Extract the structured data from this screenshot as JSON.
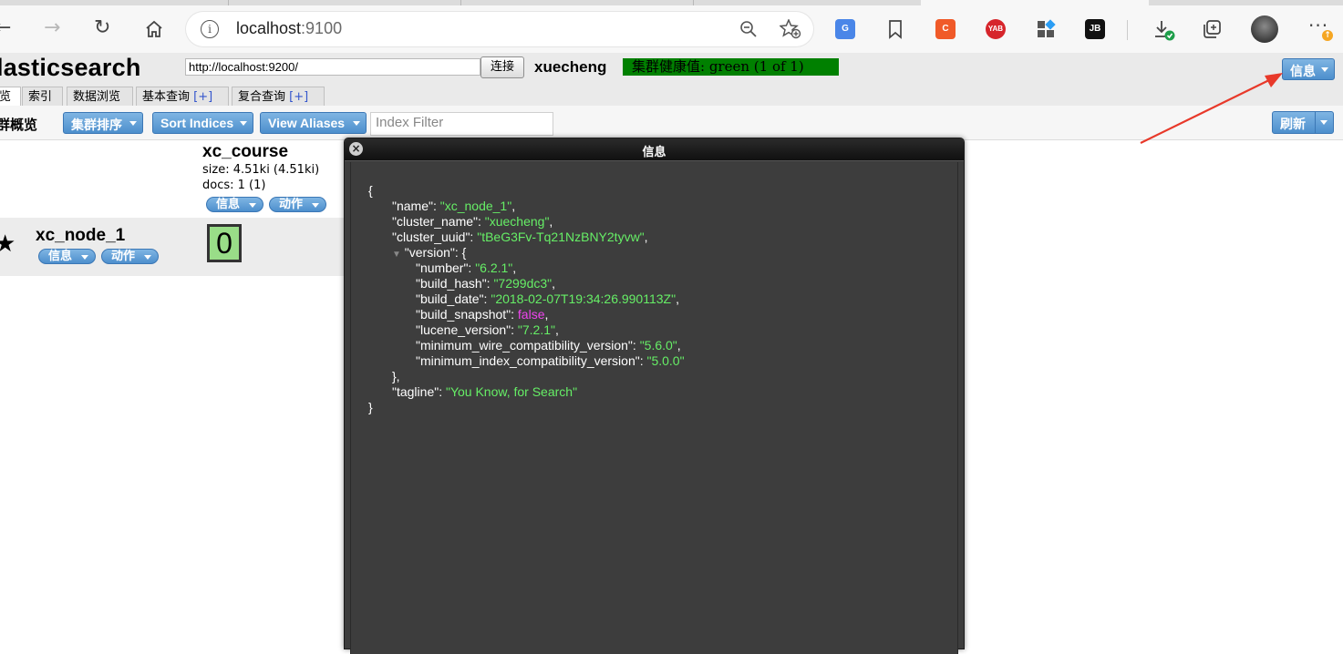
{
  "browser": {
    "address": "localhost",
    "address_port": ":9100",
    "extensions": [
      "translate-icon",
      "bookmark-icon",
      "c-extension-icon",
      "yab-extension-icon",
      "apps-icon",
      "jb-extension-icon",
      "download-icon",
      "collections-icon",
      "profile-avatar",
      "more-icon"
    ],
    "ext_labels": {
      "c": "C",
      "yab": "YAB",
      "jb": "JB"
    }
  },
  "app": {
    "title": "lasticsearch",
    "connection_url": "http://localhost:9200/",
    "connect_label": "连接",
    "cluster_name": "xuecheng",
    "health_text": "集群健康值: green (1 of 1)",
    "info_menu_label": "信息",
    "tabs": [
      {
        "label": "览",
        "plus": ""
      },
      {
        "label": "索引",
        "plus": ""
      },
      {
        "label": "数据浏览",
        "plus": ""
      },
      {
        "label": "基本查询",
        "plus": "[+]"
      },
      {
        "label": "复合查询",
        "plus": "[+]"
      }
    ],
    "overview_label": "群概览",
    "cluster_sort_label": "集群排序",
    "sort_indices_label": "Sort Indices",
    "view_aliases_label": "View Aliases",
    "index_filter_placeholder": "Index Filter",
    "refresh_label": "刷新"
  },
  "index": {
    "name": "xc_course",
    "size": "size: 4.51ki (4.51ki)",
    "docs": "docs: 1 (1)",
    "info_label": "信息",
    "action_label": "动作"
  },
  "node": {
    "name": "xc_node_1",
    "info_label": "信息",
    "action_label": "动作",
    "shard": "0"
  },
  "dialog": {
    "title": "信息",
    "json_lines": [
      {
        "k": "",
        "v": "{"
      },
      {
        "k": "\"name\": ",
        "v": "\"xc_node_1\"",
        "t": ","
      },
      {
        "k": "\"cluster_name\": ",
        "v": "\"xuecheng\"",
        "t": ","
      },
      {
        "k": "\"cluster_uuid\": ",
        "v": "\"tBeG3Fv-Tq21NzBNY2tyvw\"",
        "t": ","
      },
      {
        "k": "\"version\": {",
        "v": ""
      },
      {
        "k": "\"number\": ",
        "v": "\"6.2.1\"",
        "t": ","
      },
      {
        "k": "\"build_hash\": ",
        "v": "\"7299dc3\"",
        "t": ","
      },
      {
        "k": "\"build_date\": ",
        "v": "\"2018-02-07T19:34:26.990113Z\"",
        "t": ","
      },
      {
        "k": "\"build_snapshot\": ",
        "b": "false",
        "t": ","
      },
      {
        "k": "\"lucene_version\": ",
        "v": "\"7.2.1\"",
        "t": ","
      },
      {
        "k": "\"minimum_wire_compatibility_version\": ",
        "v": "\"5.6.0\"",
        "t": ","
      },
      {
        "k": "\"minimum_index_compatibility_version\": ",
        "v": "\"5.0.0\""
      },
      {
        "k": "},",
        "v": ""
      },
      {
        "k": "\"tagline\": ",
        "v": "\"You Know, for Search\""
      },
      {
        "k": "}",
        "v": ""
      }
    ]
  },
  "colors": {
    "health_green": "#008000",
    "json_string": "#66ee66",
    "json_bool": "#ee44ee",
    "button_blue": "#4d8fcd",
    "arrow_red": "#e8392a"
  }
}
